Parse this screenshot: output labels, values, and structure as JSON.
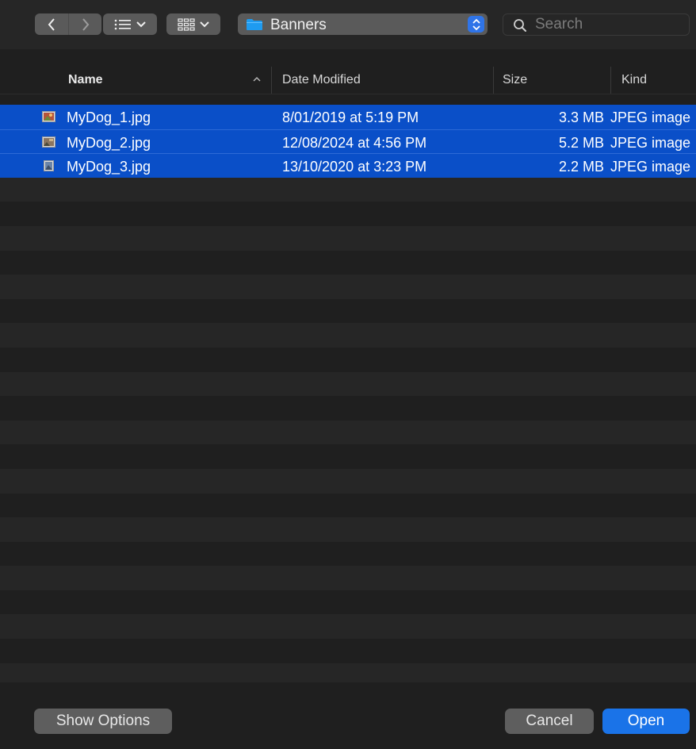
{
  "toolbar": {
    "nav": {
      "back_icon": "chevron-left-icon",
      "forward_icon": "chevron-right-icon"
    },
    "view_list_icon": "list-view-icon",
    "view_gallery_icon": "icon-grid-icon",
    "path": {
      "label": "Banners",
      "icon": "folder-icon",
      "folder_color": "#1e9bf0"
    },
    "search": {
      "placeholder": "Search",
      "value": ""
    }
  },
  "columns": {
    "name": "Name",
    "date_modified": "Date Modified",
    "size": "Size",
    "kind": "Kind",
    "sort": "ascending"
  },
  "files": [
    {
      "name": "MyDog_1.jpg",
      "date_modified": "8/01/2019 at 5:19 PM",
      "size": "3.3 MB",
      "kind": "JPEG image",
      "selected": true
    },
    {
      "name": "MyDog_2.jpg",
      "date_modified": "12/08/2024 at 4:56 PM",
      "size": "5.2 MB",
      "kind": "JPEG image",
      "selected": true
    },
    {
      "name": "MyDog_3.jpg",
      "date_modified": "13/10/2020 at 3:23 PM",
      "size": "2.2 MB",
      "kind": "JPEG image",
      "selected": true
    }
  ],
  "footer": {
    "show_options": "Show Options",
    "cancel": "Cancel",
    "open": "Open"
  },
  "colors": {
    "accent": "#1a73e8",
    "selection": "#0a4fc8",
    "background": "#1f1f1f"
  }
}
